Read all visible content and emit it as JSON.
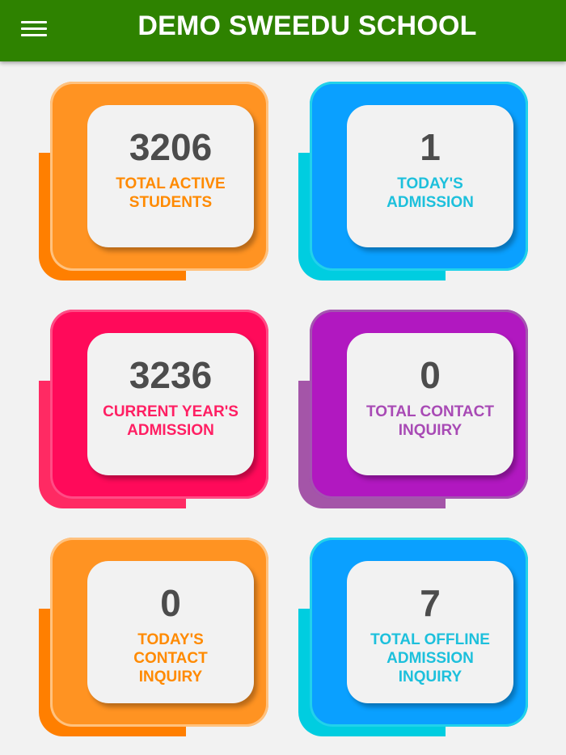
{
  "app": {
    "title": "DEMO SWEEDU SCHOOL",
    "header_color": "#2e8200",
    "menu_icon": "hamburger-menu-icon"
  },
  "cards": [
    {
      "value": "3206",
      "label": "TOTAL ACTIVE\nSTUDENTS",
      "theme": "orange"
    },
    {
      "value": "1",
      "label": "TODAY'S\nADMISSION",
      "theme": "blue"
    },
    {
      "value": "3236",
      "label": "CURRENT YEAR'S\nADMISSION",
      "theme": "pink"
    },
    {
      "value": "0",
      "label": "TOTAL CONTACT\nINQUIRY",
      "theme": "purple"
    },
    {
      "value": "0",
      "label": "TODAY'S\nCONTACT\nINQUIRY",
      "theme": "orange"
    },
    {
      "value": "7",
      "label": "TOTAL OFFLINE\nADMISSION\nINQUIRY",
      "theme": "blue"
    }
  ],
  "theme_colors": {
    "orange": "#ff9322",
    "blue": "#0aa0ff",
    "pink": "#ff0a5a",
    "purple": "#b118c0"
  }
}
